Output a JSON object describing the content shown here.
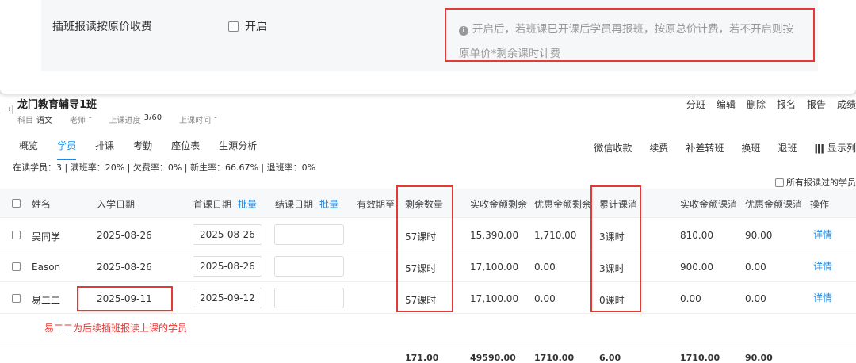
{
  "setting": {
    "label": "插班报读按原价收费",
    "checkbox_label": "开启",
    "tip_line1": "开启后，若班课已开课后学员再报班，按原总价计费，若不开启则按",
    "tip_line2": "原单价*剩余课时计费"
  },
  "class_info": {
    "title": "龙门教育辅导1班",
    "subject_label": "科目",
    "subject_value": "语文",
    "teacher_label": "老师",
    "teacher_value": "-",
    "progress_label": "上课进度",
    "progress_value": "3/60",
    "time_label": "上课时间",
    "time_value": "-"
  },
  "top_actions": [
    "分班",
    "编辑",
    "删除",
    "报名",
    "报告",
    "成绩"
  ],
  "tabs": [
    "概览",
    "学员",
    "排课",
    "考勤",
    "座位表",
    "生源分析"
  ],
  "active_tab": "学员",
  "right_actions": [
    "微信收款",
    "续费",
    "补差转班",
    "换班",
    "退班"
  ],
  "column_display": "显示列",
  "stats": "在读学员：3 | 满班率：20% | 欠费率：0% | 新生率：66.67% | 退班率：0%",
  "all_students_checkbox": "所有报读过的学员",
  "columns": {
    "name": "姓名",
    "enroll_date": "入学日期",
    "first_date": "首课日期",
    "end_date": "结课日期",
    "batch": "批量",
    "valid_until": "有效期至",
    "remaining": "剩余数量",
    "paid_remaining": "实收金额剩余",
    "discount_remaining": "优惠金额剩余",
    "consumed": "累计课消",
    "paid_consumed": "实收金额课消",
    "discount_consumed": "优惠金额课消",
    "ops": "操作"
  },
  "rows": [
    {
      "name": "吴同学",
      "enroll_date": "2025-08-26",
      "first_date": "2025-08-26",
      "end_date": "",
      "remaining": "57课时",
      "paid_remaining": "15,390.00",
      "discount_remaining": "1,710.00",
      "consumed": "3课时",
      "paid_consumed": "810.00",
      "discount_consumed": "90.00",
      "op": "详情"
    },
    {
      "name": "Eason",
      "enroll_date": "2025-08-26",
      "first_date": "2025-08-26",
      "end_date": "",
      "remaining": "57课时",
      "paid_remaining": "17,100.00",
      "discount_remaining": "0.00",
      "consumed": "3课时",
      "paid_consumed": "900.00",
      "discount_consumed": "0.00",
      "op": "详情"
    },
    {
      "name": "易二二",
      "enroll_date": "2025-09-11",
      "first_date": "2025-09-12",
      "end_date": "",
      "remaining": "57课时",
      "paid_remaining": "17,100.00",
      "discount_remaining": "0.00",
      "consumed": "0课时",
      "paid_consumed": "0.00",
      "discount_consumed": "0.00",
      "op": "详情"
    }
  ],
  "note": "易二二为后续插班报读上课的学员",
  "totals": {
    "remaining": "171.00",
    "paid_remaining": "49590.00",
    "discount_remaining": "1710.00",
    "consumed": "6.00",
    "paid_consumed": "1710.00",
    "discount_consumed": "90.00"
  },
  "colors": {
    "accent": "#1e88e5",
    "highlight": "#e53935"
  }
}
